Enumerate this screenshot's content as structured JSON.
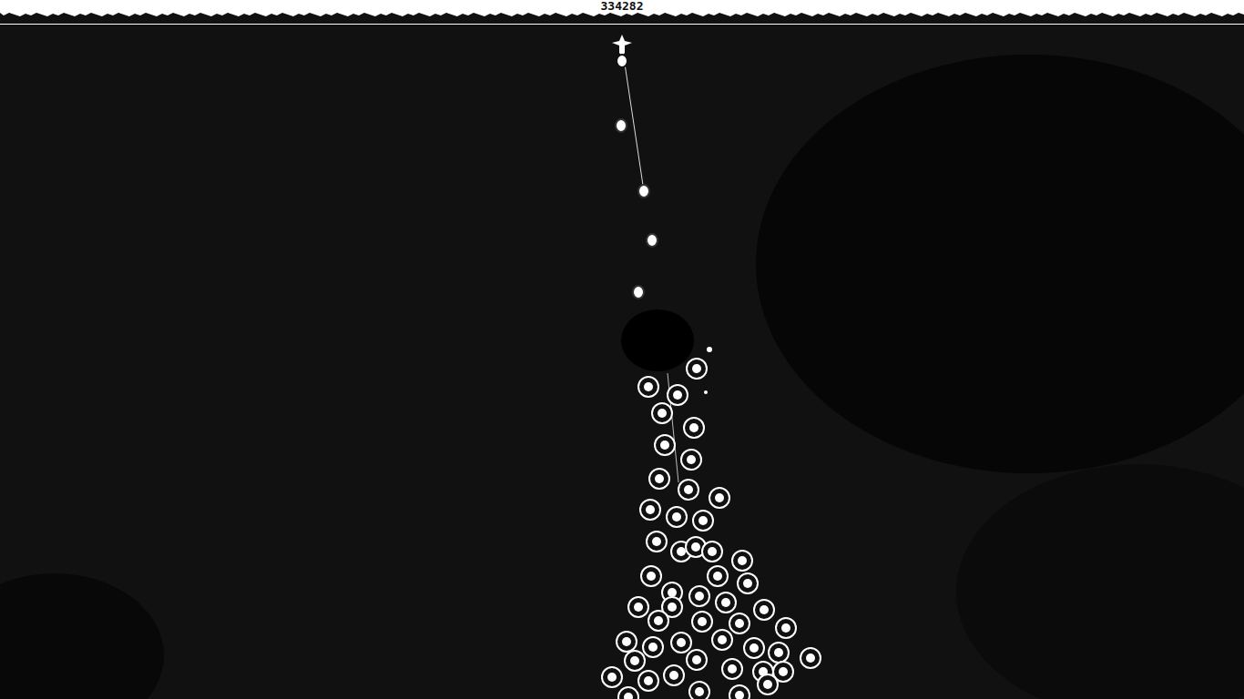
{
  "hud": {
    "score": "334282"
  },
  "player": {
    "alive": true
  }
}
